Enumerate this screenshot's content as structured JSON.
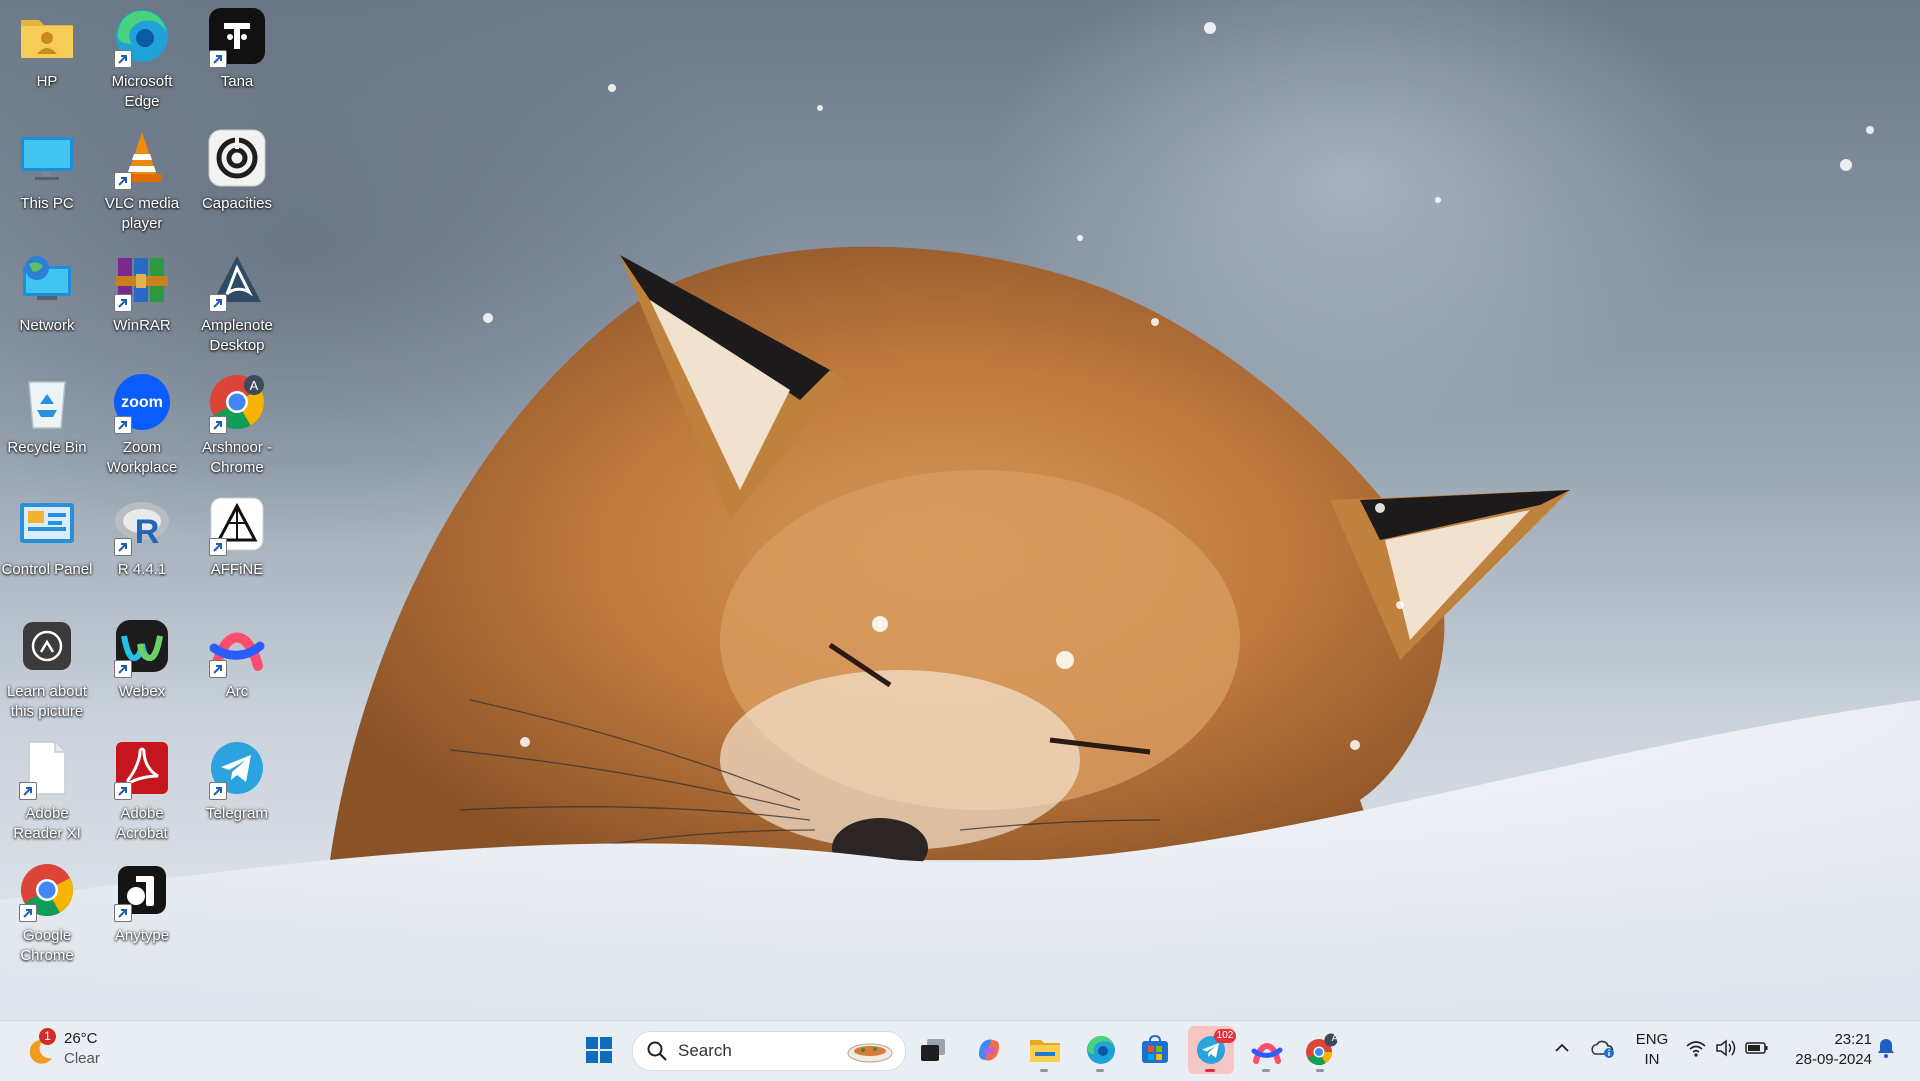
{
  "desktop": {
    "icons": [
      {
        "label": "HP",
        "icon": "user-folder-icon"
      },
      {
        "label": "Microsoft Edge",
        "icon": "edge-icon"
      },
      {
        "label": "Tana",
        "icon": "tana-icon"
      },
      {
        "label": "This PC",
        "icon": "monitor-icon"
      },
      {
        "label": "VLC media player",
        "icon": "vlc-cone-icon"
      },
      {
        "label": "Capacities",
        "icon": "capacities-icon"
      },
      {
        "label": "Network",
        "icon": "network-globe-icon"
      },
      {
        "label": "WinRAR",
        "icon": "winrar-books-icon"
      },
      {
        "label": "Amplenote Desktop",
        "icon": "amplenote-icon"
      },
      {
        "label": "Recycle Bin",
        "icon": "recycle-bin-icon"
      },
      {
        "label": "Zoom Workplace",
        "icon": "zoom-icon"
      },
      {
        "label": "Arshnoor - Chrome",
        "icon": "chrome-profile-icon"
      },
      {
        "label": "Control Panel",
        "icon": "control-panel-icon"
      },
      {
        "label": "R 4.4.1",
        "icon": "r-language-icon"
      },
      {
        "label": "AFFiNE",
        "icon": "affine-icon"
      },
      {
        "label": "Learn about this picture",
        "icon": "camera-info-icon"
      },
      {
        "label": "Webex",
        "icon": "webex-icon"
      },
      {
        "label": "Arc",
        "icon": "arc-icon"
      },
      {
        "label": "Adobe Reader XI",
        "icon": "document-icon"
      },
      {
        "label": "Adobe Acrobat",
        "icon": "acrobat-icon"
      },
      {
        "label": "Telegram",
        "icon": "telegram-icon"
      },
      {
        "label": "Google Chrome",
        "icon": "chrome-icon"
      },
      {
        "label": "Anytype",
        "icon": "anytype-icon"
      }
    ]
  },
  "taskbar": {
    "weather": {
      "temp": "26°C",
      "condition": "Clear",
      "badge": "1"
    },
    "search": {
      "placeholder": "Search"
    },
    "telegram_badge": "102",
    "chrome_profile_letter": "A",
    "language": {
      "line1": "ENG",
      "line2": "IN"
    },
    "clock": {
      "time": "23:21",
      "date": "28-09-2024"
    }
  },
  "colors": {
    "taskbar_bg": "#e9eef4",
    "windows_blue": "#0f6cbd",
    "telegram_blue": "#2aa3df",
    "badge_red": "#d42b2b"
  }
}
